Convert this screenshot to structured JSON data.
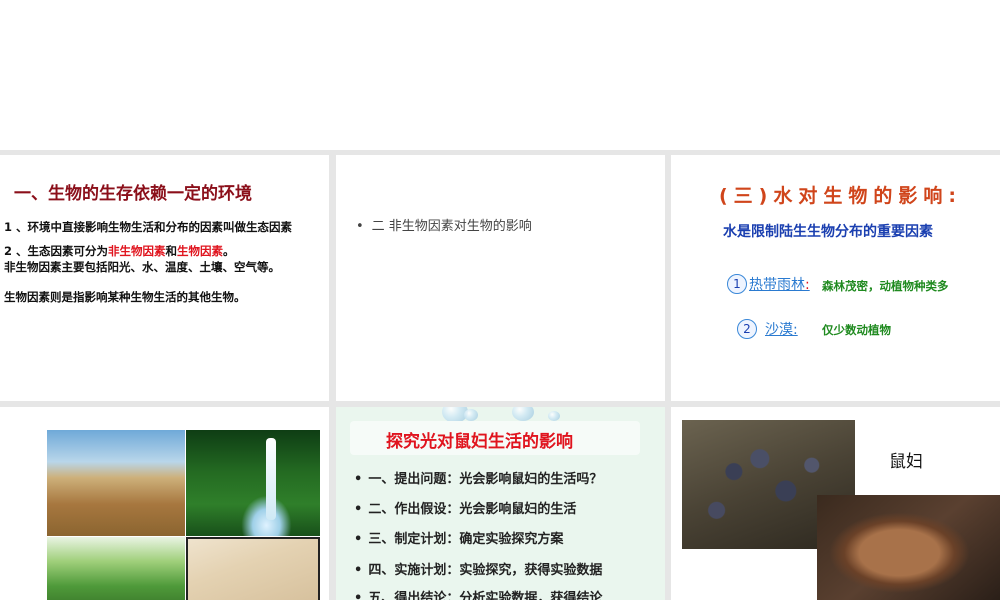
{
  "slides": {
    "s1": {
      "title": "一、生物的生存依赖一定的环境",
      "line1": "1 、环境中直接影响生物生活和分布的因素叫做生态因素",
      "line2_pre": "2 、生态因素可分为",
      "line2_red1": "非生物因素",
      "line2_mid": "和",
      "line2_red2": "生物因素",
      "line2_post": "。",
      "line3": "非生物因素主要包括阳光、水、温度、土壤、空气等。",
      "line4": "生物因素则是指影响某种生物生活的其他生物。"
    },
    "s2": {
      "bullet": "二  非生物因素对生物的影响"
    },
    "s3": {
      "title": "(三)水对生物的影响:",
      "subtitle": "水是限制陆生生物分布的重要因素",
      "items": [
        {
          "num": "1",
          "term": "热带雨林",
          "sep": ":",
          "desc": "森林茂密，动植物种类多"
        },
        {
          "num": "2",
          "term": "沙漠",
          "sep": ":",
          "desc": "仅少数动植物"
        }
      ]
    },
    "s5": {
      "title": "探究光对鼠妇生活的影响",
      "items": [
        "一、提出问题：光会影响鼠妇的生活吗？",
        "二、作出假设：光会影响鼠妇的生活",
        "三、制定计划：确定实验探究方案",
        "四、实施计划：实验探究，获得实验数据",
        "五、得出结论：分析实验数据，获得结论"
      ]
    },
    "s6": {
      "label": "鼠妇"
    }
  },
  "bullet_char": "•",
  "colors": {
    "title_red": "#8b0f1a",
    "red": "#e0141e",
    "blue": "#1a3fb0",
    "green": "#1f8a1f",
    "orange": "#d0451b"
  }
}
